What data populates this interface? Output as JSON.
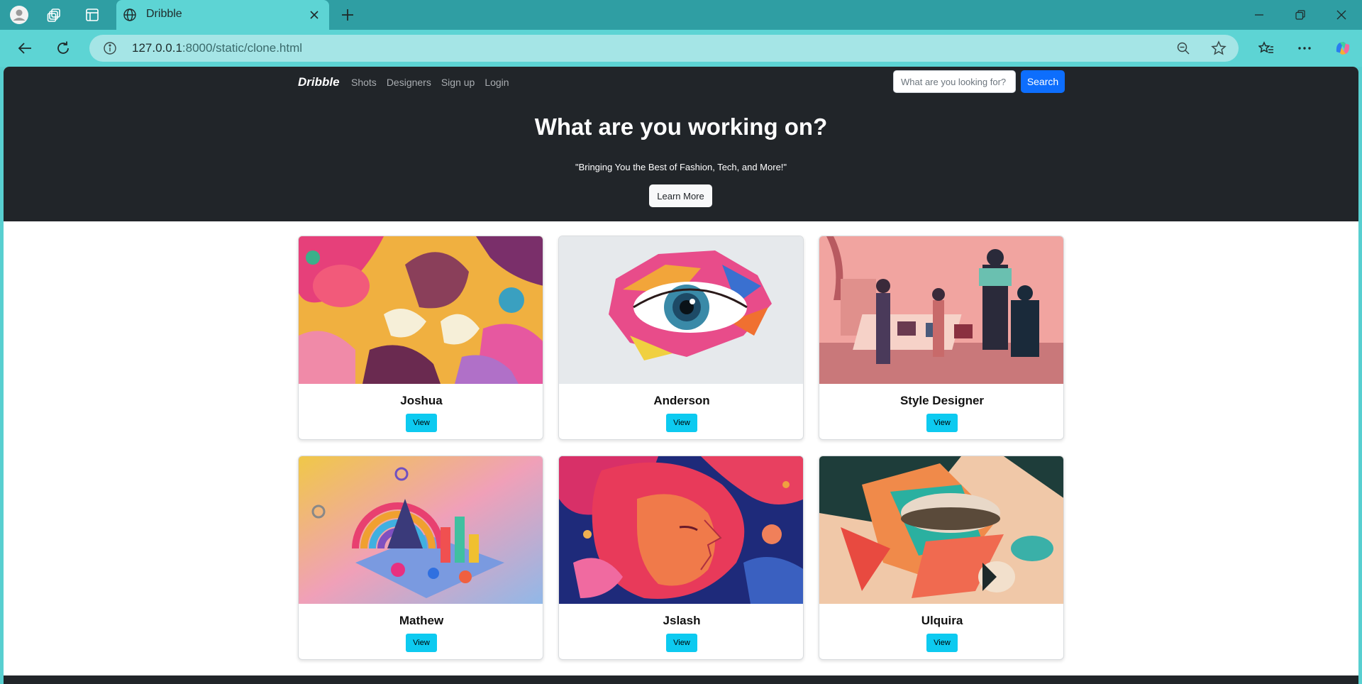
{
  "browser": {
    "tab_title": "Dribble",
    "url_host": "127.0.0.1",
    "url_path": ":8000/static/clone.html"
  },
  "site": {
    "brand": "Dribble",
    "nav": [
      "Shots",
      "Designers",
      "Sign up",
      "Login"
    ],
    "search_placeholder": "What are you looking for?",
    "search_button": "Search"
  },
  "hero": {
    "title": "What are you working on?",
    "subtitle": "\"Bringing You the Best of Fashion, Tech, and More!\"",
    "cta": "Learn More"
  },
  "cards": [
    {
      "name": "Joshua",
      "button": "View"
    },
    {
      "name": "Anderson",
      "button": "View"
    },
    {
      "name": "Style Designer",
      "button": "View"
    },
    {
      "name": "Mathew",
      "button": "View"
    },
    {
      "name": "Jslash",
      "button": "View"
    },
    {
      "name": "Ulquira",
      "button": "View"
    }
  ]
}
